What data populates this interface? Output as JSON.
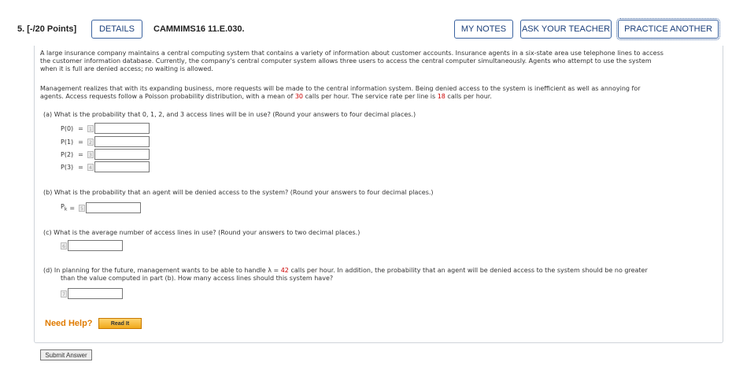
{
  "header": {
    "question_number": "5.",
    "points": "[-/20 Points]",
    "details_label": "DETAILS",
    "code": "CAMMIMS16 11.E.030.",
    "my_notes_label": "MY NOTES",
    "ask_teacher_label": "ASK YOUR TEACHER",
    "practice_another_label": "PRACTICE ANOTHER"
  },
  "intro": {
    "line1": "A large insurance company maintains a central computing system that contains a variety of information about customer accounts. Insurance agents in a six-state area use telephone lines to access",
    "line2": "the customer information database. Currently, the company's central computer system allows three users to access the central computer simultaneously. Agents who attempt to use the system",
    "line3": "when it is full are denied access; no waiting is allowed."
  },
  "management": {
    "line1": "Management realizes that with its expanding business, more requests will be made to the central information system. Being denied access to the system is inefficient as well as annoying for",
    "line2_before": "agents. Access requests follow a Poisson probability distribution, with a mean of ",
    "mean_calls": "30",
    "line2_middle": " calls per hour. The service rate per line is ",
    "service_rate": "18",
    "line2_after": " calls per hour."
  },
  "part_a": {
    "question": "(a)  What is the probability that 0, 1, 2, and 3 access lines will be in use? (Round your answers to four decimal places.)",
    "rows": [
      {
        "label": "P(0)",
        "eq": "=",
        "num": "1"
      },
      {
        "label": "P(1)",
        "eq": "=",
        "num": "2"
      },
      {
        "label": "P(2)",
        "eq": "=",
        "num": "3"
      },
      {
        "label": "P(3)",
        "eq": "=",
        "num": "4"
      }
    ]
  },
  "part_b": {
    "question": "(b)  What is the probability that an agent will be denied access to the system? (Round your answers to four decimal places.)",
    "label_p": "P",
    "label_sub": "k",
    "eq": "=",
    "num": "5"
  },
  "part_c": {
    "question": "(c)  What is the average number of access lines in use? (Round your answers to two decimal places.)",
    "num": "6"
  },
  "part_d": {
    "line1_before": "(d)  In planning for the future, management wants to be able to handle λ = ",
    "lambda_value": "42",
    "line1_after": " calls per hour. In addition, the probability that an agent will be denied access to the system should be no greater",
    "line2": "than the value computed in part (b). How many access lines should this system have?",
    "num": "7"
  },
  "footer": {
    "need_help": "Need Help?",
    "read_it": "Read It",
    "submit": "Submit Answer"
  }
}
